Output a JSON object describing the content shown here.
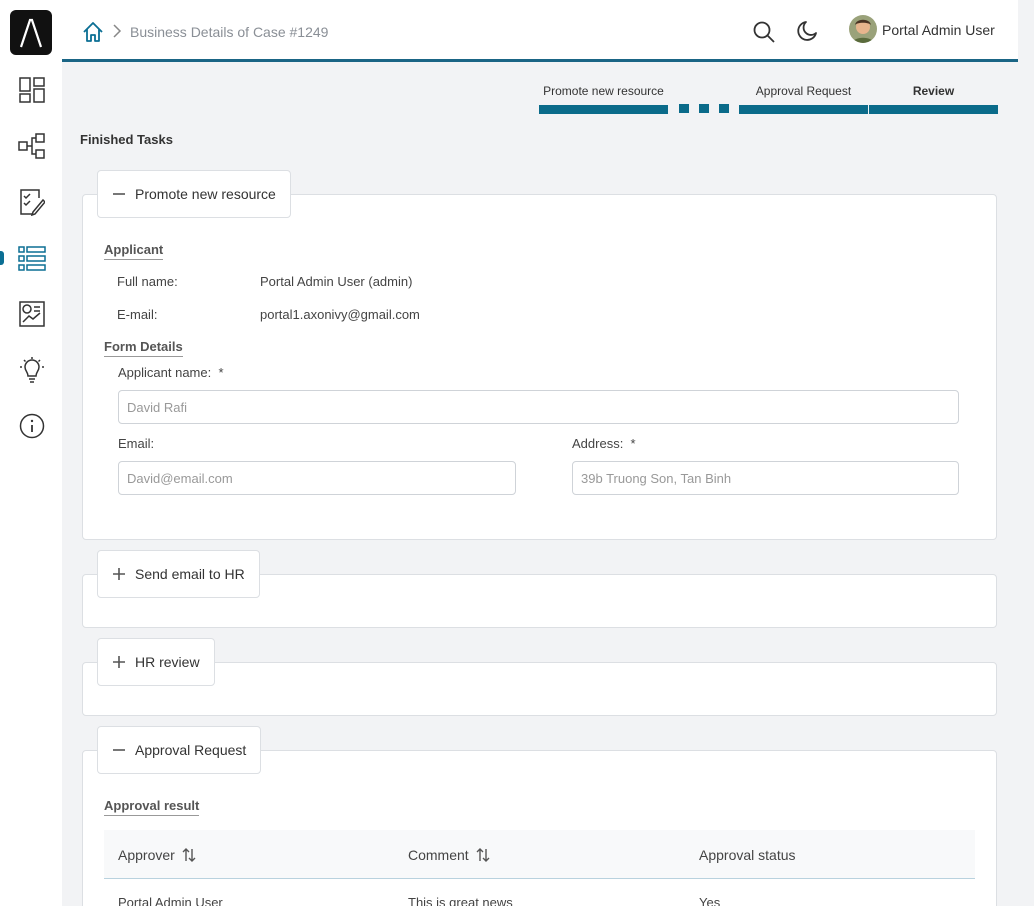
{
  "header": {
    "breadcrumb": "Business Details of Case #1249",
    "user_name": "Portal Admin User"
  },
  "sidebar": {
    "items": [
      {
        "icon": "dashboard-icon"
      },
      {
        "icon": "process-icon"
      },
      {
        "icon": "task-icon"
      },
      {
        "icon": "case-list-icon",
        "active": true
      },
      {
        "icon": "statistics-icon"
      },
      {
        "icon": "idea-icon"
      },
      {
        "icon": "info-icon"
      }
    ]
  },
  "stepper": {
    "steps": [
      "Promote new resource",
      "Approval Request",
      "Review"
    ],
    "current": "Review"
  },
  "finished_tasks_title": "Finished Tasks",
  "tasks": [
    {
      "name": "Promote new resource",
      "expanded": true,
      "applicant_title": "Applicant",
      "full_name_label": "Full name:",
      "full_name_value": "Portal Admin User (admin)",
      "email_label": "E-mail:",
      "email_value": "portal1.axonivy@gmail.com",
      "form_details_title": "Form Details",
      "applicant_name_label": "Applicant name:  *",
      "applicant_name_value": "David Rafi",
      "email_field_label": "Email:",
      "email_field_value": "David@email.com",
      "address_label": "Address:  *",
      "address_value": "39b Truong Son, Tan Binh"
    },
    {
      "name": "Send email to HR",
      "expanded": false
    },
    {
      "name": "HR review",
      "expanded": false
    },
    {
      "name": "Approval Request",
      "expanded": true,
      "approval_result_title": "Approval result",
      "columns": [
        "Approver",
        "Comment",
        "Approval status"
      ],
      "rows": [
        [
          "Portal Admin User",
          "This is great news",
          "Yes"
        ]
      ]
    }
  ],
  "colors": {
    "accent": "#0b6b8a",
    "topbar_border": "#1a6585"
  }
}
